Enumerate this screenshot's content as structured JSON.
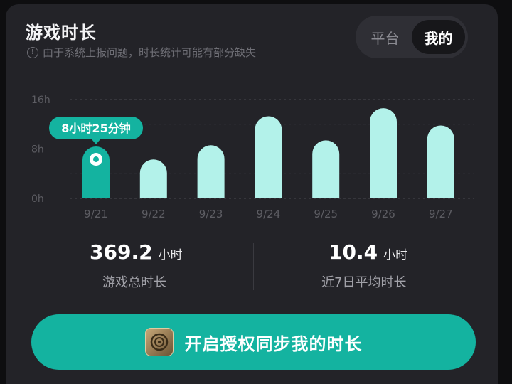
{
  "header": {
    "title": "游戏时长",
    "notice": "由于系统上报问题，时长统计可能有部分缺失",
    "notice_icon": "info-icon",
    "tabs": [
      {
        "label": "平台",
        "active": false
      },
      {
        "label": "我的",
        "active": true
      }
    ]
  },
  "chart_data": {
    "type": "bar",
    "categories": [
      "9/21",
      "9/22",
      "9/23",
      "9/24",
      "9/25",
      "9/26",
      "9/27"
    ],
    "values": [
      8.4,
      6.3,
      8.6,
      13.3,
      9.4,
      14.6,
      11.8
    ],
    "yticks": [
      "16h",
      "8h",
      "0h"
    ],
    "ylim": [
      0,
      16
    ],
    "grid": true,
    "selected_index": 0,
    "tooltip": "8小时25分钟",
    "colors": {
      "selected": "#14b3a0",
      "bar": "#b3f2ea",
      "grid": "#4a4a50",
      "tick": "#5d5d63"
    }
  },
  "stats": [
    {
      "value": "369.2",
      "unit": "小时",
      "label": "游戏总时长"
    },
    {
      "value": "10.4",
      "unit": "小时",
      "label": "近7日平均时长"
    }
  ],
  "action": {
    "label": "开启授权同步我的时长",
    "icon": "game-app-icon",
    "color": "#14b3a0"
  }
}
